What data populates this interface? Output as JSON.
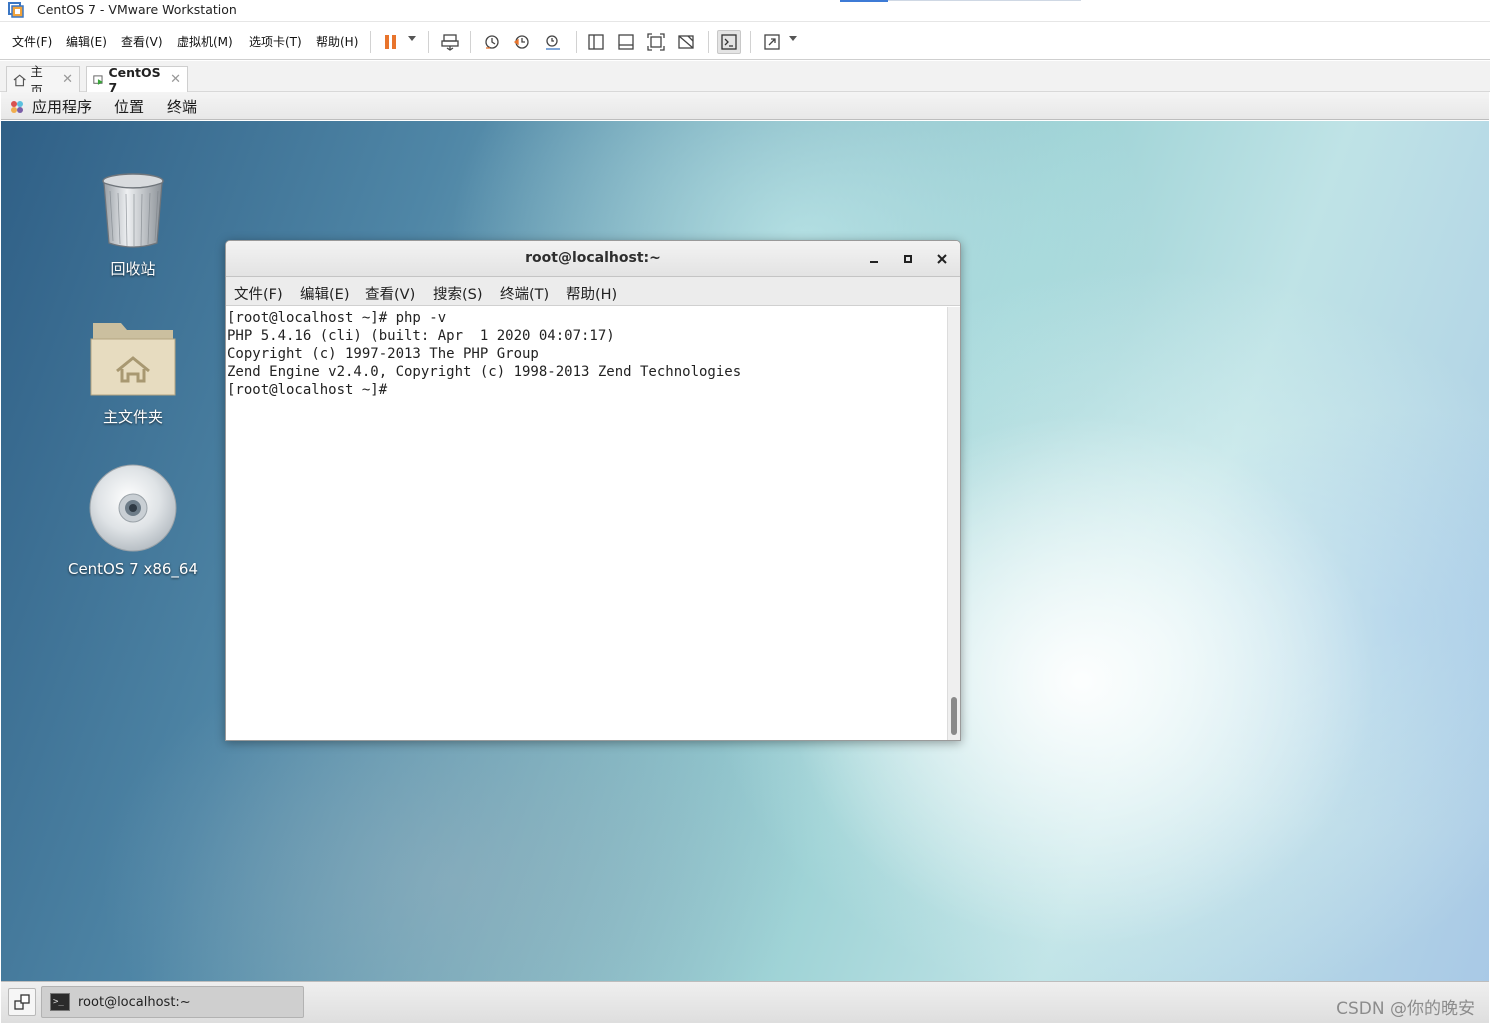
{
  "window": {
    "title": "CentOS 7 - VMware Workstation",
    "accent_color": "#3d7bd6"
  },
  "menu": {
    "items": [
      "文件(F)",
      "编辑(E)",
      "查看(V)",
      "虚拟机(M)",
      "选项卡(T)",
      "帮助(H)"
    ]
  },
  "toolbar": {
    "icons": [
      "pause-icon",
      "send-ctrl-alt-del-icon",
      "snapshot-take-icon",
      "snapshot-revert-icon",
      "snapshot-manager-icon",
      "library-view-icon",
      "thumbnail-view-icon",
      "fullscreen-icon",
      "unity-icon",
      "console-view-icon",
      "stretch-icon"
    ],
    "pause_color": "#e8742c"
  },
  "tabs": [
    {
      "label": "主页",
      "icon": "home-icon"
    },
    {
      "label": "CentOS 7",
      "icon": "vm-tab-icon",
      "active": true
    }
  ],
  "guest_panel": {
    "items": [
      "应用程序",
      "位置",
      "终端"
    ]
  },
  "desktop": {
    "icons": [
      {
        "label": "回收站",
        "icon": "trash-icon"
      },
      {
        "label": "主文件夹",
        "icon": "home-folder-icon"
      },
      {
        "label": "CentOS 7 x86_64",
        "icon": "disc-icon"
      }
    ]
  },
  "terminal": {
    "title": "root@localhost:~",
    "menu": [
      "文件(F)",
      "编辑(E)",
      "查看(V)",
      "搜索(S)",
      "终端(T)",
      "帮助(H)"
    ],
    "lines": [
      "[root@localhost ~]# php -v",
      "PHP 5.4.16 (cli) (built: Apr  1 2020 04:07:17)",
      "Copyright (c) 1997-2013 The PHP Group",
      "Zend Engine v2.4.0, Copyright (c) 1998-2013 Zend Technologies",
      "[root@localhost ~]# "
    ]
  },
  "taskbar": {
    "task_label": "root@localhost:~",
    "watermark": "CSDN @你的晚安"
  }
}
